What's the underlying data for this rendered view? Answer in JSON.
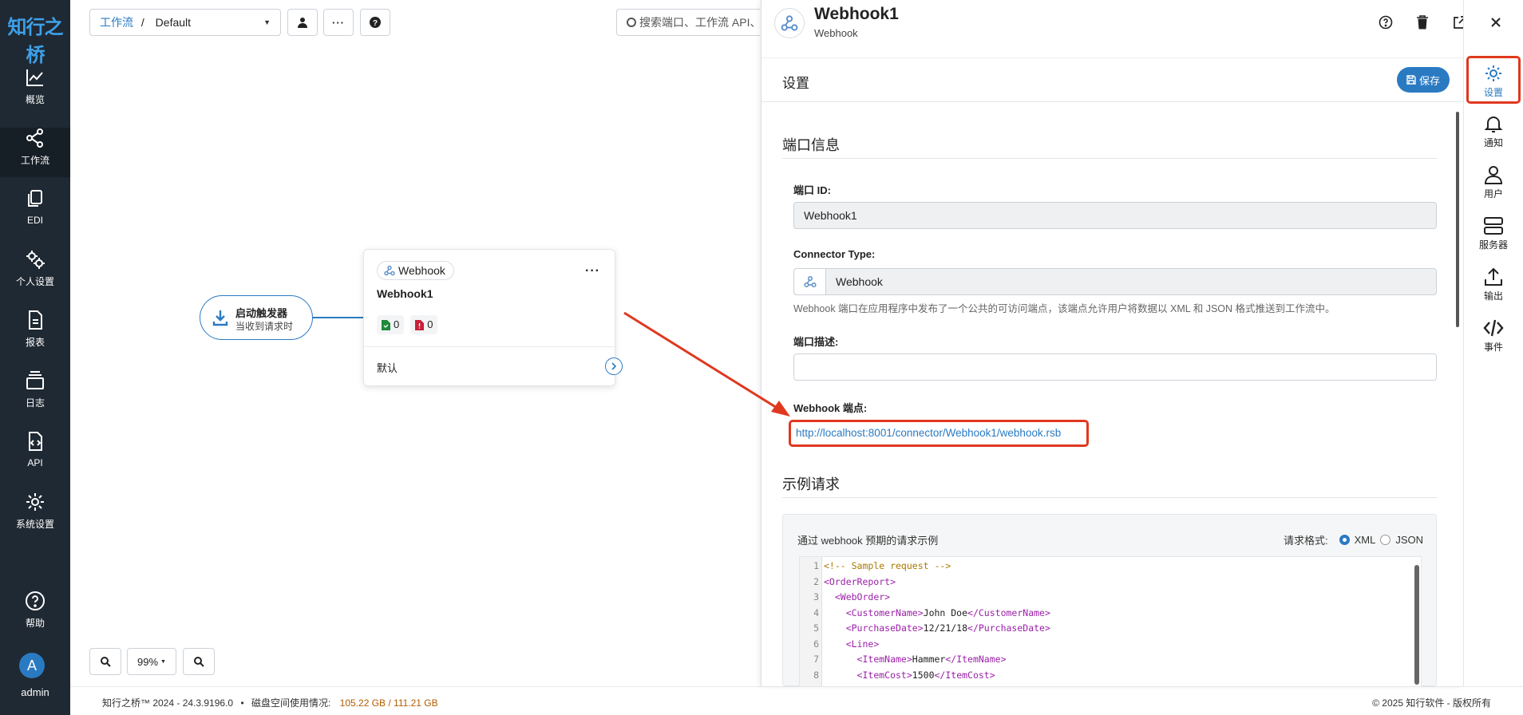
{
  "app": {
    "logo_text": "知行之桥",
    "nav": [
      {
        "label": "概览",
        "icon": "chart-line-icon"
      },
      {
        "label": "工作流",
        "icon": "share-nodes-icon"
      },
      {
        "label": "EDI",
        "icon": "documents-icon"
      },
      {
        "label": "个人设置",
        "icon": "gears-icon"
      },
      {
        "label": "报表",
        "icon": "report-icon"
      },
      {
        "label": "日志",
        "icon": "layers-icon"
      },
      {
        "label": "API",
        "icon": "code-file-icon"
      },
      {
        "label": "系统设置",
        "icon": "gear-icon"
      },
      {
        "label": "帮助",
        "icon": "help-icon"
      }
    ],
    "user": {
      "initial": "A",
      "name": "admin"
    }
  },
  "toolbar": {
    "breadcrumb_link": "工作流",
    "breadcrumb_sep": "/",
    "breadcrumb_current": "Default",
    "search_placeholder": "搜索端口、工作流 API、偶"
  },
  "canvas": {
    "trigger": {
      "title": "启动触发器",
      "subtitle": "当收到请求时"
    },
    "node": {
      "chip_label": "Webhook",
      "title": "Webhook1",
      "success_count": "0",
      "error_count": "0",
      "port_label": "默认"
    },
    "zoom_level": "99%"
  },
  "footer": {
    "version": "知行之桥™ 2024 - 24.3.9196.0",
    "disk_label": "磁盘空间使用情况:",
    "disk_value": "105.22 GB / 111.21 GB",
    "copyright": "© 2025 知行软件 - 版权所有"
  },
  "panel": {
    "title": "Webhook1",
    "subtitle": "Webhook",
    "settings_title": "设置",
    "save_label": "保存",
    "port_info_title": "端口信息",
    "port_id_label": "端口 ID:",
    "port_id_value": "Webhook1",
    "connector_type_label": "Connector Type:",
    "connector_type_value": "Webhook",
    "connector_hint": "Webhook 端口在应用程序中发布了一个公共的可访问端点，该端点允许用户将数据以 XML 和 JSON 格式推送到工作流中。",
    "port_desc_label": "端口描述:",
    "endpoint_label": "Webhook 端点:",
    "endpoint_url": "http://localhost:8001/connector/Webhook1/webhook.rsb",
    "sample_title": "示例请求",
    "sample_desc": "通过 webhook 预期的请求示例",
    "format_label": "请求格式:",
    "format_xml": "XML",
    "format_json": "JSON",
    "code_lines": [
      {
        "n": "1",
        "indent": "",
        "parts": [
          {
            "t": "<!-- Sample request -->",
            "k": "com"
          }
        ]
      },
      {
        "n": "2",
        "indent": "",
        "parts": [
          {
            "t": "<OrderReport>",
            "k": "tag"
          }
        ]
      },
      {
        "n": "3",
        "indent": "  ",
        "parts": [
          {
            "t": "<WebOrder>",
            "k": "tag"
          }
        ]
      },
      {
        "n": "4",
        "indent": "    ",
        "parts": [
          {
            "t": "<CustomerName>",
            "k": "tag"
          },
          {
            "t": "John Doe",
            "k": "txt"
          },
          {
            "t": "</CustomerName>",
            "k": "tag"
          }
        ]
      },
      {
        "n": "5",
        "indent": "    ",
        "parts": [
          {
            "t": "<PurchaseDate>",
            "k": "tag"
          },
          {
            "t": "12/21/18",
            "k": "txt"
          },
          {
            "t": "</PurchaseDate>",
            "k": "tag"
          }
        ]
      },
      {
        "n": "6",
        "indent": "    ",
        "parts": [
          {
            "t": "<Line>",
            "k": "tag"
          }
        ]
      },
      {
        "n": "7",
        "indent": "      ",
        "parts": [
          {
            "t": "<ItemName>",
            "k": "tag"
          },
          {
            "t": "Hammer",
            "k": "txt"
          },
          {
            "t": "</ItemName>",
            "k": "tag"
          }
        ]
      },
      {
        "n": "8",
        "indent": "      ",
        "parts": [
          {
            "t": "<ItemCost>",
            "k": "tag"
          },
          {
            "t": "1500",
            "k": "txt"
          },
          {
            "t": "</ItemCost>",
            "k": "tag"
          }
        ]
      }
    ]
  },
  "rail": [
    {
      "label": "设置",
      "icon": "gear-icon"
    },
    {
      "label": "通知",
      "icon": "bell-icon"
    },
    {
      "label": "用户",
      "icon": "user-icon"
    },
    {
      "label": "服务器",
      "icon": "server-icon"
    },
    {
      "label": "输出",
      "icon": "upload-icon"
    },
    {
      "label": "事件",
      "icon": "code-icon"
    }
  ],
  "colors": {
    "accent": "#2a7ac2",
    "highlight": "#e0381f",
    "nav_bg": "#1f2933"
  }
}
